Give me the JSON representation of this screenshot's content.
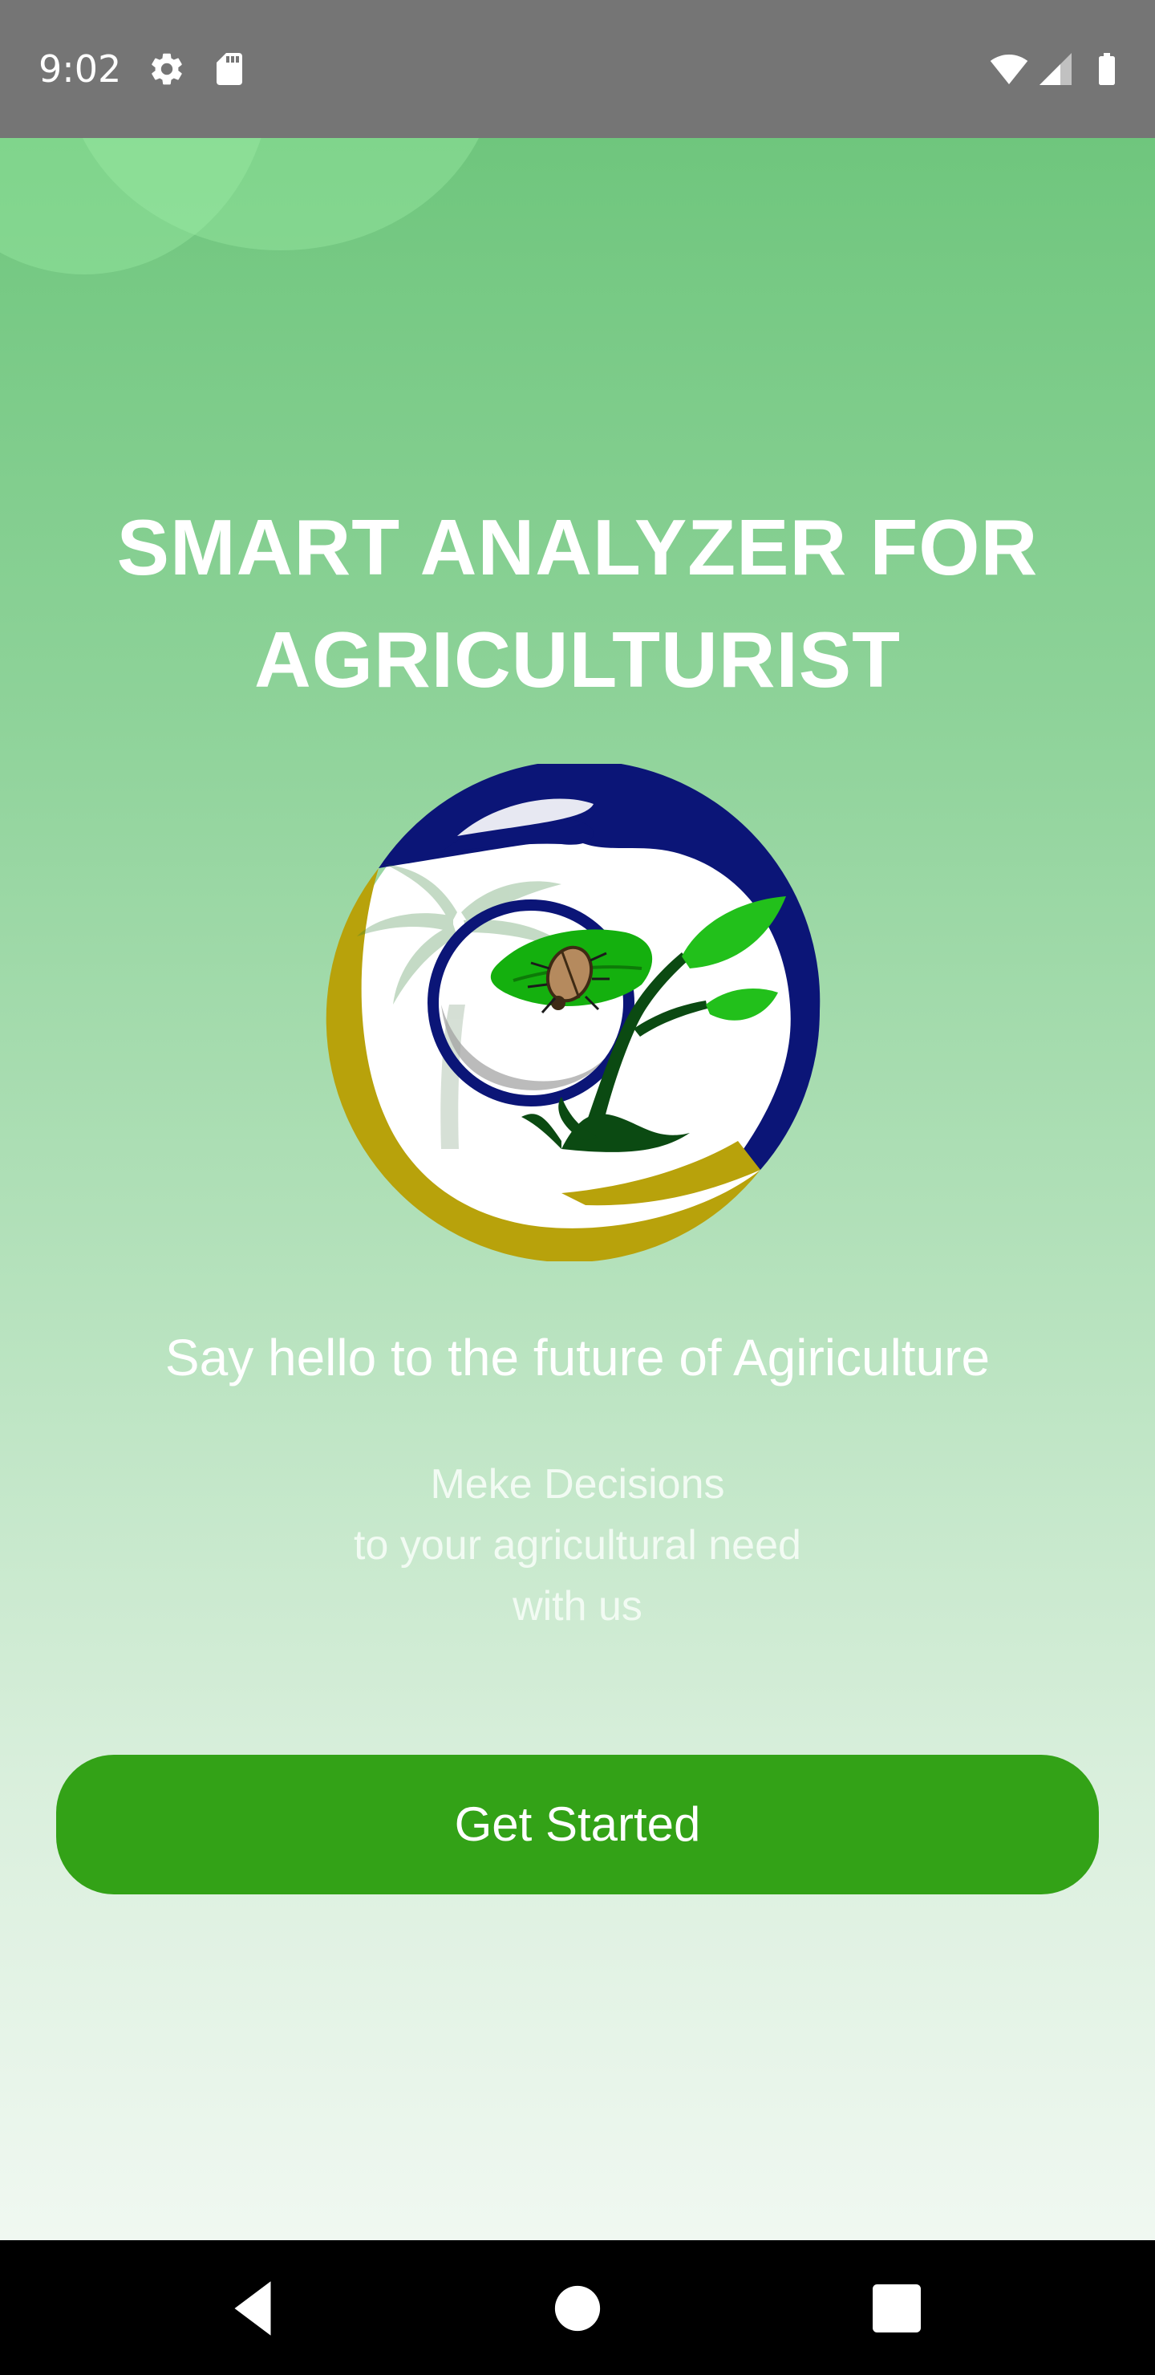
{
  "status_bar": {
    "time": "9:02",
    "icons": [
      "gear-icon",
      "sd-card-icon",
      "wifi-icon",
      "cell-signal-icon",
      "battery-icon"
    ],
    "color": "#757575"
  },
  "app": {
    "title_line1": "SMART ANALYZER FOR",
    "title_line2": "AGRICULTURIST",
    "logo_icon": "leaf-hands-beetle-logo",
    "tagline": "Say hello to the future of Agiriculture",
    "subtext": [
      "Meke Decisions",
      "to your agricultural need",
      "with us"
    ],
    "get_started_label": "Get Started",
    "button_color": "#33a217",
    "gradient_top": "#6fc67d",
    "gradient_bottom": "#f0f8f1"
  },
  "nav_bar": {
    "icons": [
      "back-icon",
      "home-icon",
      "recents-icon"
    ]
  }
}
